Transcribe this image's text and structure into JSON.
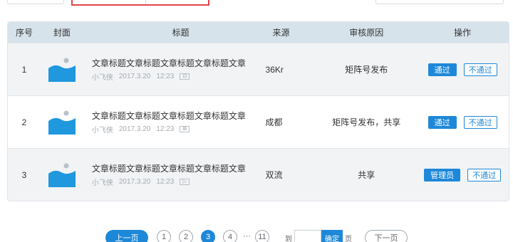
{
  "table": {
    "headers": {
      "index": "序号",
      "cover": "封面",
      "title": "标题",
      "source": "来源",
      "reason": "审核原因",
      "ops": "操作"
    },
    "rows": [
      {
        "index": "1",
        "title": "文章标题文章标题文章标题文章标题文章",
        "author": "小飞侠",
        "date": "2017.3.20",
        "time": "12:23",
        "type_icon": "image-icon",
        "type_glyph": "⊡",
        "source": "36Kr",
        "reason": "矩阵号发布",
        "primary_action": "通过",
        "secondary_action": "不通过"
      },
      {
        "index": "2",
        "title": "文章标题文章标题文章标题文章标题文章",
        "author": "小飞侠",
        "date": "2017.3.20",
        "time": "12:23",
        "type_icon": "article-icon",
        "type_glyph": "⊠",
        "source": "成都",
        "reason": "矩阵号发布，共享",
        "primary_action": "通过",
        "secondary_action": "不通过"
      },
      {
        "index": "3",
        "title": "文章标题文章标题文章标题文章标题文章",
        "author": "小飞侠",
        "date": "2017.3.20",
        "time": "12:23",
        "type_icon": "video-icon",
        "type_glyph": "▷",
        "source": "双流",
        "reason": "共享",
        "primary_action": "管理员",
        "secondary_action": "不通过"
      }
    ]
  },
  "pagination": {
    "prev": "上一页",
    "pages": [
      "1",
      "2",
      "3",
      "4"
    ],
    "current": "3",
    "ellipsis": "···",
    "last": "11",
    "goto_label": "到",
    "goto_value": "",
    "confirm": "确定",
    "page_label": "页",
    "next": "下一页"
  },
  "colors": {
    "accent": "#1e88d8",
    "header_bg": "#d7e3eb",
    "highlight_border": "#e0454b"
  }
}
